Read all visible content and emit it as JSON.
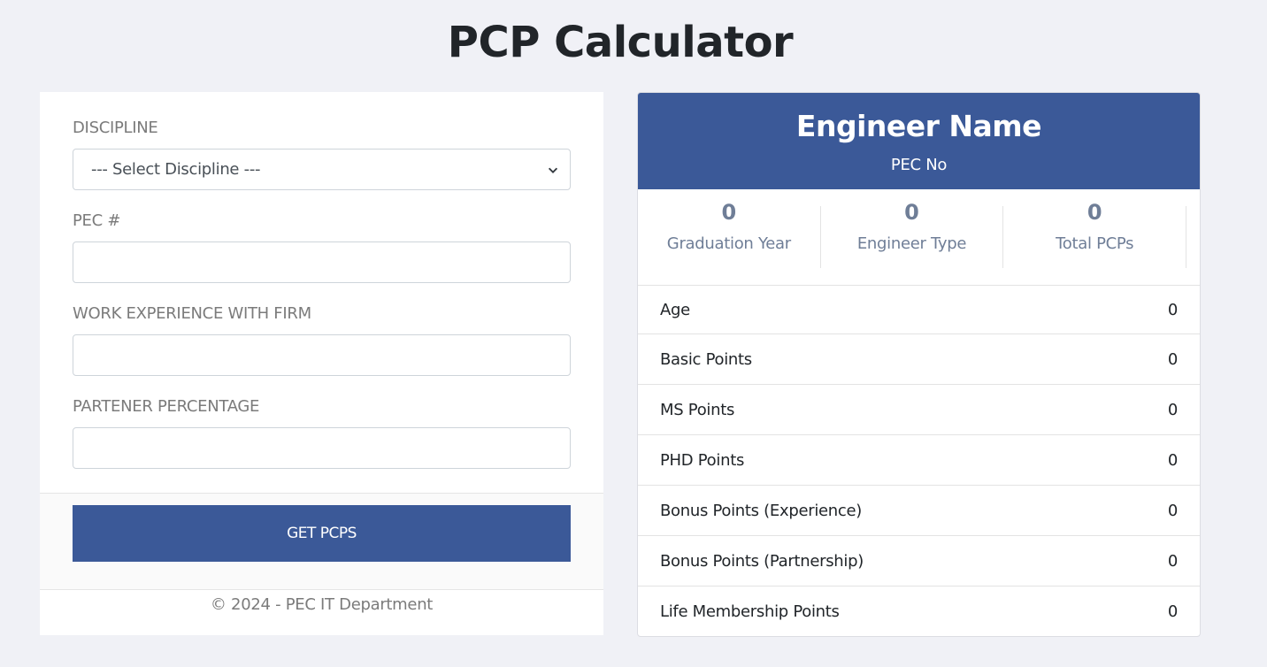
{
  "page": {
    "title": "PCP Calculator"
  },
  "form": {
    "fields": [
      {
        "label": "DISCIPLINE",
        "type": "select",
        "value": "--- Select Discipline ---"
      },
      {
        "label": "PEC #",
        "type": "text",
        "value": "",
        "placeholder": ""
      },
      {
        "label": "WORK EXPERIENCE WITH FIRM",
        "type": "text",
        "value": "",
        "placeholder": ""
      },
      {
        "label": "PARTENER PERCENTAGE",
        "type": "text",
        "value": "",
        "placeholder": ""
      }
    ],
    "submit_label": "GET PCPS",
    "footer": "© 2024 - PEC IT Department"
  },
  "result": {
    "name": "Engineer Name",
    "pec_no": "PEC No",
    "stats": [
      {
        "value": "0",
        "label": "Graduation Year"
      },
      {
        "value": "0",
        "label": "Engineer Type"
      },
      {
        "value": "0",
        "label": "Total PCPs"
      }
    ],
    "rows": [
      {
        "label": "Age",
        "value": "0"
      },
      {
        "label": "Basic Points",
        "value": "0"
      },
      {
        "label": "MS Points",
        "value": "0"
      },
      {
        "label": "PHD Points",
        "value": "0"
      },
      {
        "label": "Bonus Points (Experience)",
        "value": "0"
      },
      {
        "label": "Bonus Points (Partnership)",
        "value": "0"
      },
      {
        "label": "Life Membership Points",
        "value": "0"
      }
    ]
  },
  "colors": {
    "accent": "#3b5998",
    "background": "#f0f1f6",
    "stat_text": "#6f7e97"
  }
}
